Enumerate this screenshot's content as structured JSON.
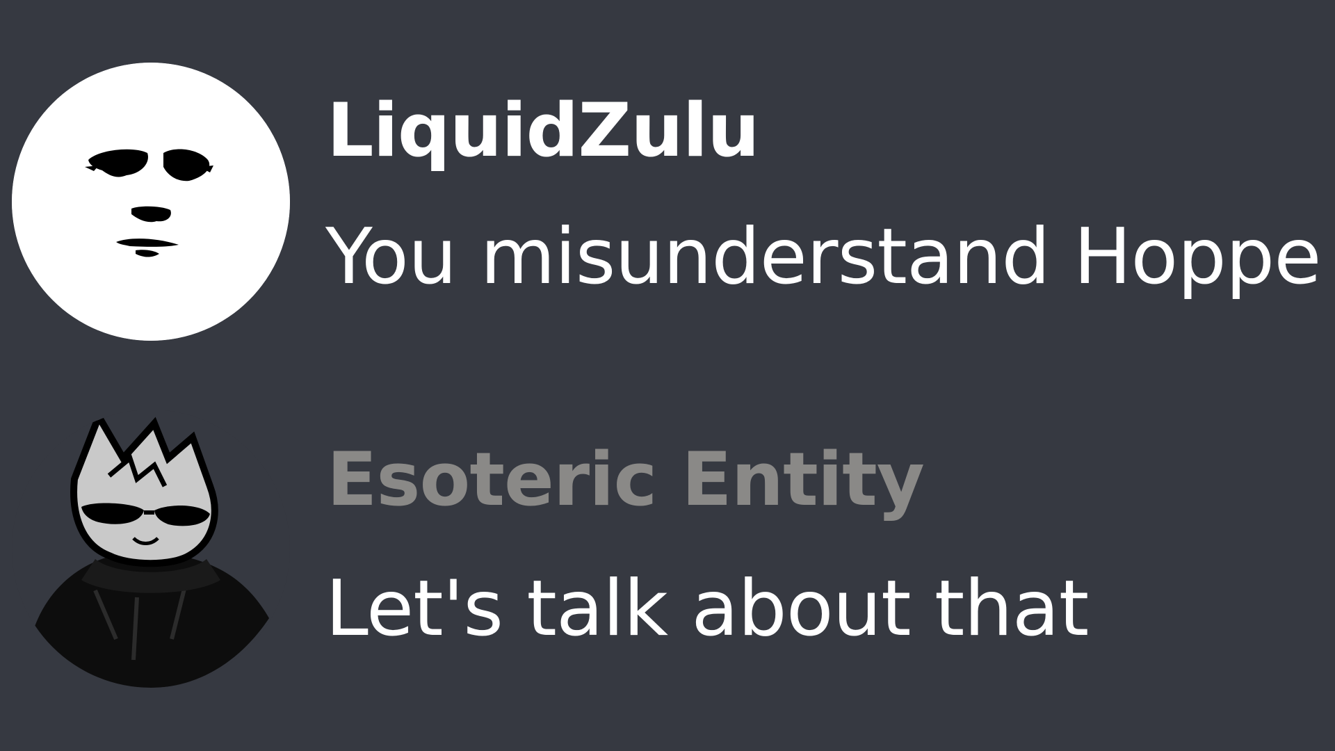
{
  "messages": [
    {
      "username": "LiquidZulu",
      "text": "You misunderstand Hoppe",
      "username_color": "#ffffff",
      "avatar_icon": "moon-face-avatar"
    },
    {
      "username": "Esoteric Entity",
      "text": "Let's talk about that",
      "username_color": "#8a8987",
      "avatar_icon": "cat-sunglasses-avatar"
    }
  ],
  "colors": {
    "background": "#363941",
    "message_text": "#ffffff"
  }
}
